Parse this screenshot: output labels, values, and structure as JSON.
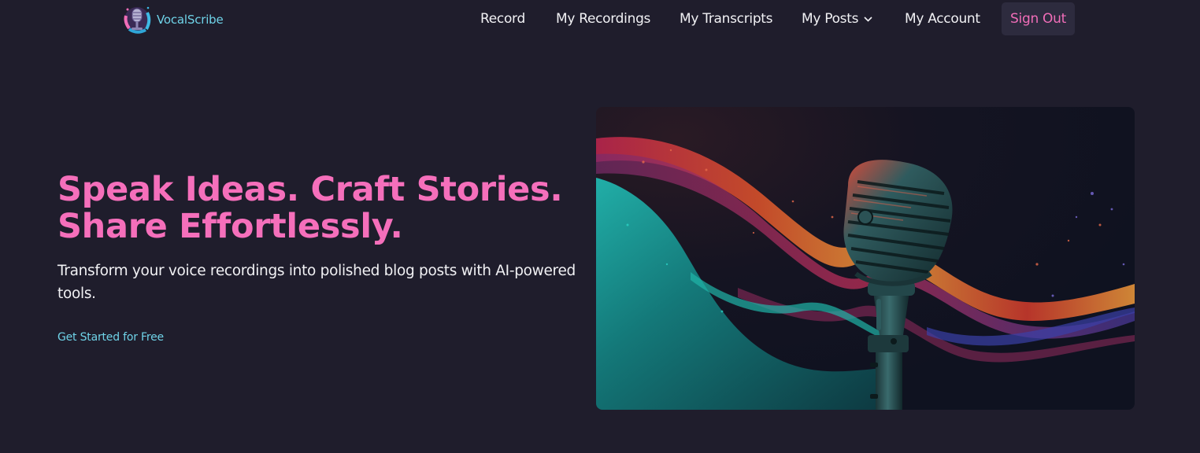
{
  "brand": {
    "name": "VocalScribe",
    "logo_icon": "microphone-logo-icon",
    "color": "#6fd3e8"
  },
  "nav": {
    "items": [
      {
        "label": "Record"
      },
      {
        "label": "My Recordings"
      },
      {
        "label": "My Transcripts"
      },
      {
        "label": "My Posts",
        "icon": "chevron-down-icon"
      },
      {
        "label": "My Account"
      }
    ],
    "sign_out": "Sign Out"
  },
  "hero": {
    "title_line1": "Speak Ideas. Craft Stories.",
    "title_line2": "Share Effortlessly.",
    "subtitle": "Transform your voice recordings into polished blog posts with AI-powered tools.",
    "cta": "Get Started for Free",
    "image_icon": "microphone-sound-waves-illustration"
  },
  "colors": {
    "background": "#1f1d2c",
    "accent_pink": "#f56fbb",
    "accent_cyan": "#6fd3e8",
    "text": "#f1f1f4"
  }
}
